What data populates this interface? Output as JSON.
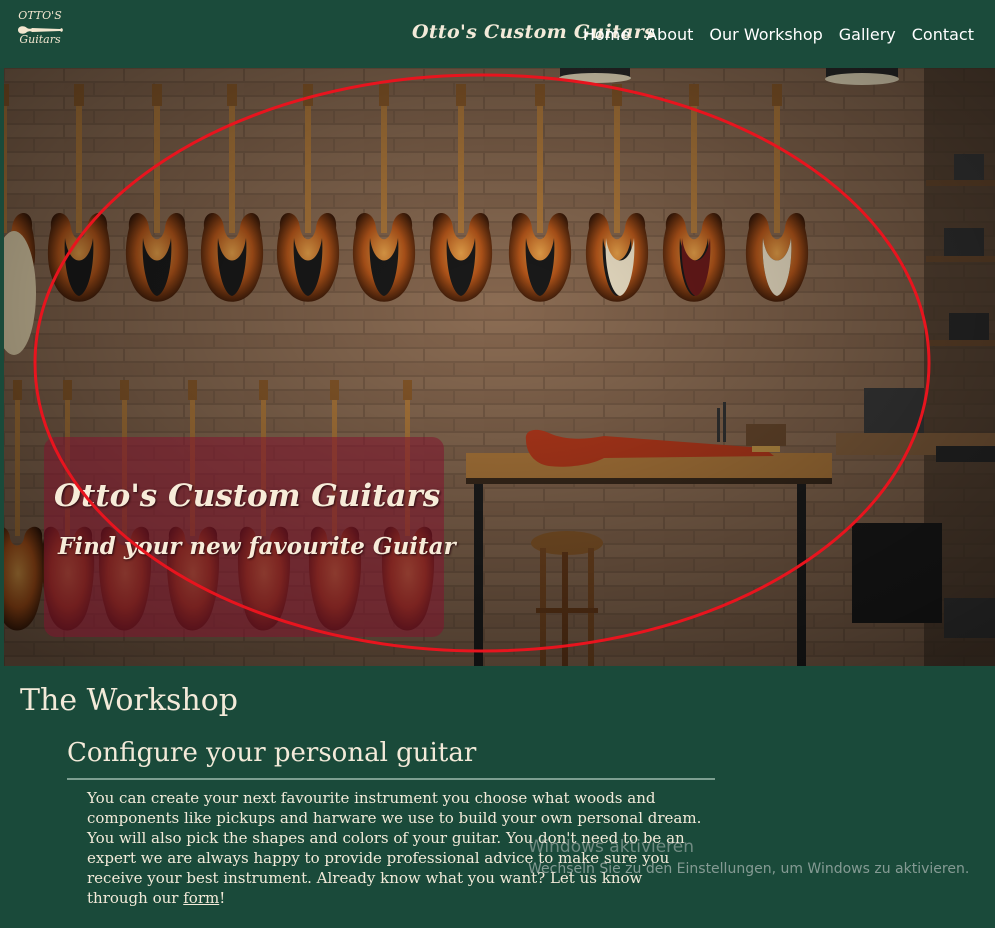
{
  "nav": {
    "logo_line1": "OTTO'S",
    "logo_line2": "Guitars",
    "brand": "Otto's Custom Guitars",
    "links": [
      "Home",
      "About",
      "Our Workshop",
      "Gallery",
      "Contact"
    ]
  },
  "hero": {
    "title": "Otto's Custom Guitars",
    "subtitle": "Find your new favourite Guitar"
  },
  "workshop": {
    "heading": "The Workshop",
    "subheading": "Configure your personal guitar",
    "paragraph": "You can create your next favourite instrument you choose what woods and components like pickups and harware we use to build your own personal dream. You will also pick the shapes and colors of your guitar. You don't need to be an expert we are always happy to provide professional advice to make sure you receive your best instrument. Already know what you want? Let us know through our",
    "link_text": "form",
    "paragraph_end": "!"
  },
  "watermark": {
    "title": "Windows aktivieren",
    "subtitle": "Wechseln Sie zu den Einstellungen, um Windows zu aktivieren."
  },
  "colors": {
    "nav_bg": "#1b4b3b",
    "page_bg": "#1a4a3a",
    "text": "#f3ead9",
    "overlay": "#82142d",
    "annotation": "#e8141e"
  }
}
